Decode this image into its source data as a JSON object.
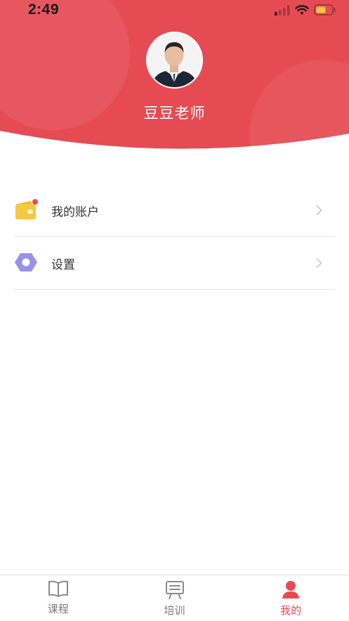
{
  "status": {
    "time": "2:49"
  },
  "profile": {
    "name": "豆豆老师"
  },
  "menu": [
    {
      "label": "我的账户",
      "icon": "wallet-icon"
    },
    {
      "label": "设置",
      "icon": "settings-hexagon-icon"
    }
  ],
  "tabs": [
    {
      "label": "课程",
      "icon": "book-icon",
      "active": false
    },
    {
      "label": "培训",
      "icon": "training-board-icon",
      "active": false
    },
    {
      "label": "我的",
      "icon": "person-icon",
      "active": true
    }
  ],
  "colors": {
    "brand": "#e64b53",
    "wallet": "#f5c842",
    "settings": "#9b8fe6",
    "badge": "#e64b53"
  }
}
